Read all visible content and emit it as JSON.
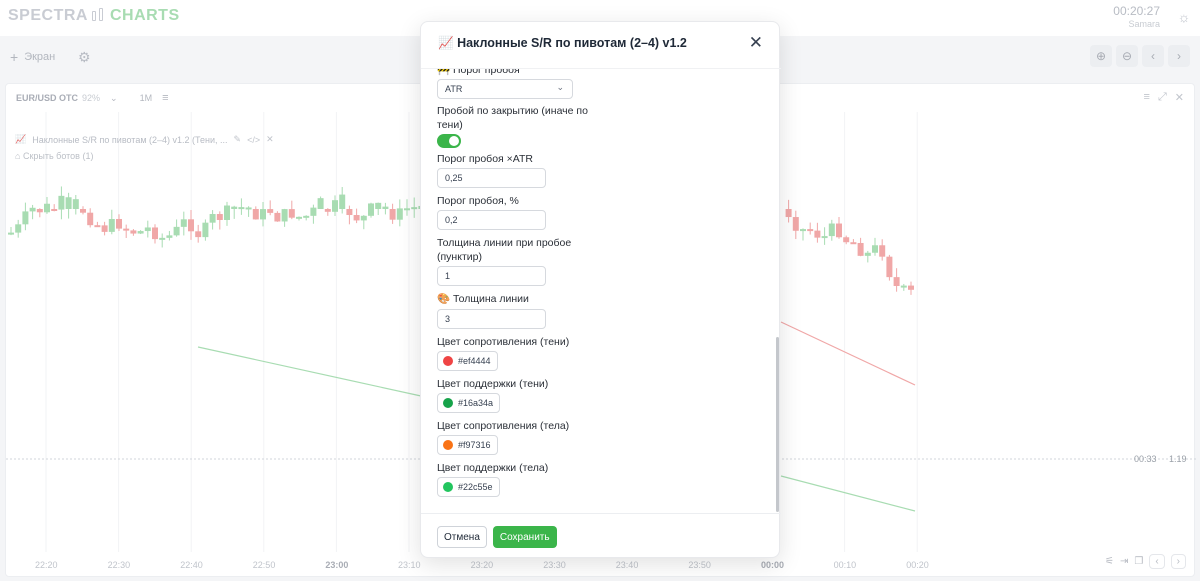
{
  "app": {
    "logo_part1": "SPECTRA",
    "logo_part2": "CHARTS",
    "clock_time": "00:20:27",
    "clock_city": "Samara",
    "theme_icon": "sun-icon"
  },
  "toolbar": {
    "screen_label": "Экран",
    "add_icon": "plus-icon",
    "settings_icon": "gear-icon",
    "zoom_in_icon": "zoom-in-icon",
    "zoom_out_icon": "zoom-out-icon",
    "prev_icon": "chevron-left-icon",
    "next_icon": "chevron-right-icon"
  },
  "chart_panel": {
    "symbol": "EUR/USD OTC",
    "payout": "92%",
    "timeframe": "1M",
    "indicator_label": "Наклонные S/R по пивотам (2–4) v1.2 (Тени, ...",
    "hide_bots": "Скрыть ботов (1)",
    "price_label": "1.19",
    "timer": "00:33",
    "time_ticks": [
      "22:20",
      "22:30",
      "22:40",
      "22:50",
      "23:00",
      "23:10",
      "23:20",
      "23:30",
      "23:40",
      "23:50",
      "00:00",
      "00:10",
      "00:20"
    ],
    "bold_ticks": [
      "23:00",
      "00:00"
    ],
    "colors": {
      "bull": "#a8dcb2",
      "bear": "#f0a7a7",
      "support_line": "#a8dcb2",
      "resistance_line": "#f0a7a7"
    }
  },
  "modal": {
    "title_icon": "📈",
    "title": "Наклонные S/R по пивотам (2–4) v1.2",
    "close_icon": "close-icon",
    "fields": {
      "breakout_threshold_label": "🚧 Порог пробоя",
      "breakout_threshold_value": "ATR",
      "close_breakout_label_1": "Пробой по закрытию (иначе по",
      "close_breakout_label_2": "тени)",
      "close_breakout_on": true,
      "atr_threshold_label": "Порог пробоя ×ATR",
      "atr_threshold_value": "0,25",
      "pct_threshold_label": "Порог пробоя, %",
      "pct_threshold_value": "0,2",
      "break_width_label_1": "Толщина линии при пробое",
      "break_width_label_2": "(пунктир)",
      "break_width_value": "1",
      "line_width_label": "🎨 Толщина линии",
      "line_width_value": "3",
      "res_wick_label": "Цвет сопротивления (тени)",
      "res_wick_color": "#ef4444",
      "sup_wick_label": "Цвет поддержки (тени)",
      "sup_wick_color": "#16a34a",
      "res_body_label": "Цвет сопротивления (тела)",
      "res_body_color": "#f97316",
      "sup_body_label": "Цвет поддержки (тела)",
      "sup_body_color": "#22c55e"
    },
    "cancel_label": "Отмена",
    "save_label": "Сохранить"
  }
}
